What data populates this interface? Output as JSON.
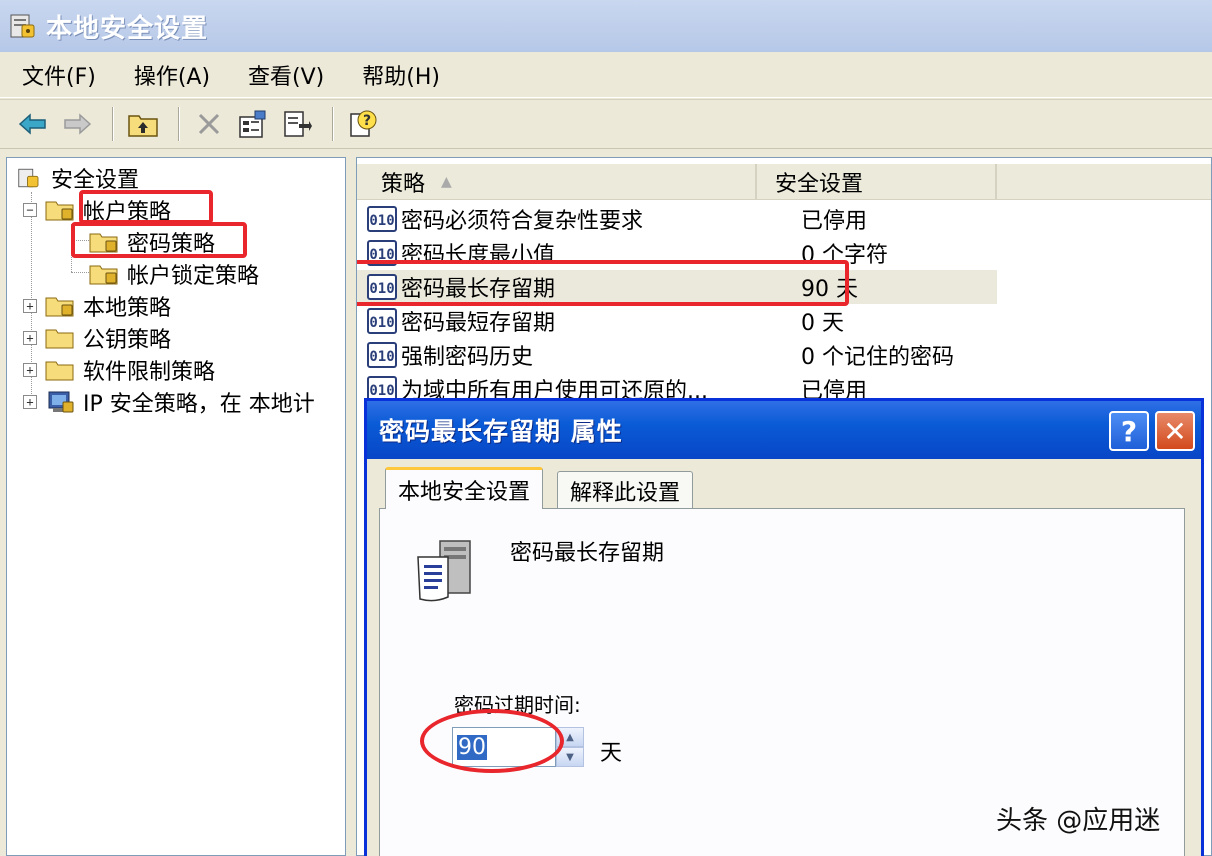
{
  "window": {
    "title": "本地安全设置"
  },
  "menu": [
    "文件(F)",
    "操作(A)",
    "查看(V)",
    "帮助(H)"
  ],
  "toolbar": [
    "back-arrow-icon",
    "forward-arrow-icon",
    "up-folder-icon",
    "delete-icon",
    "properties-icon",
    "export-list-icon",
    "help-icon"
  ],
  "tree": {
    "root": "安全设置",
    "account_policy": "帐户策略",
    "password_policy": "密码策略",
    "lockout_policy": "帐户锁定策略",
    "local_policy": "本地策略",
    "public_key_policy": "公钥策略",
    "software_restriction": "软件限制策略",
    "ip_security": "IP 安全策略，在 本地计"
  },
  "list": {
    "columns": [
      "策略",
      "安全设置"
    ],
    "rows": [
      {
        "name": "密码必须符合复杂性要求",
        "value": "已停用"
      },
      {
        "name": "密码长度最小值",
        "value": "0 个字符"
      },
      {
        "name": "密码最长存留期",
        "value": "90 天"
      },
      {
        "name": "密码最短存留期",
        "value": "0 天"
      },
      {
        "name": "强制密码历史",
        "value": "0 个记住的密码"
      },
      {
        "name": "为域中所有用户使用可还原的...",
        "value": "已停用"
      }
    ]
  },
  "dialog": {
    "title": "密码最长存留期 属性",
    "tabs": [
      "本地安全设置",
      "解释此设置"
    ],
    "policy_name": "密码最长存留期",
    "field_label": "密码过期时间:",
    "field_value": "90",
    "unit": "天",
    "help_glyph": "?",
    "close_glyph": "✕"
  },
  "watermark": "头条 @应用迷",
  "colors": {
    "highlight": "#e8262c",
    "dialog_title": "#0a5bd6"
  }
}
